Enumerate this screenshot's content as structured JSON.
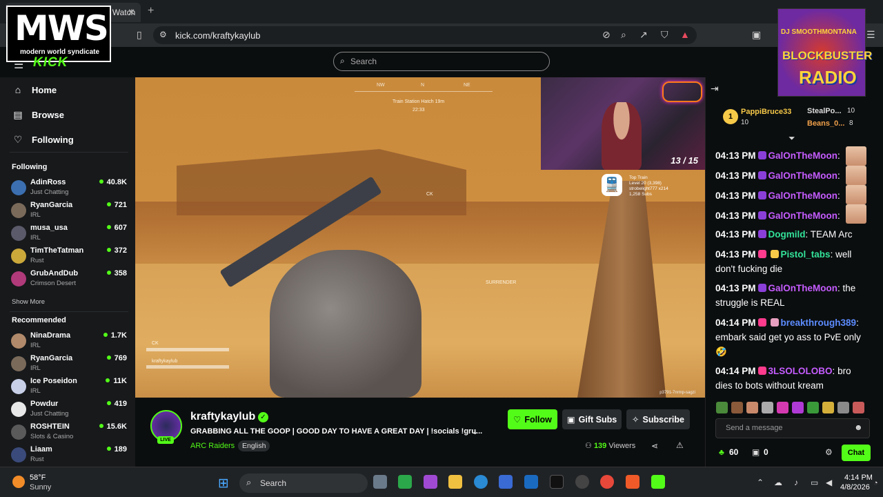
{
  "browser": {
    "tab_title": "kraftykaylub Stream - Watch",
    "tab_close": "✕",
    "new_tab": "+",
    "url": "kick.com/kraftykaylub"
  },
  "overlays": {
    "mws_big": "MWS",
    "mws_small": "modern world syndicate",
    "radio_line1": "DJ SMOOTHMONTANA",
    "radio_line2": "BLOCKBUSTER",
    "radio_line3": "RADIO"
  },
  "header": {
    "logo": "KICK",
    "search_placeholder": "Search"
  },
  "sidebar": {
    "nav": [
      {
        "label": "Home",
        "icon": "home-icon"
      },
      {
        "label": "Browse",
        "icon": "browse-icon"
      },
      {
        "label": "Following",
        "icon": "heart-icon"
      }
    ],
    "following_title": "Following",
    "following": [
      {
        "name": "AdinRoss",
        "category": "Just Chatting",
        "viewers": "40.8K",
        "color": "#3b6fb0"
      },
      {
        "name": "RyanGarcia",
        "category": "IRL",
        "viewers": "721",
        "color": "#7a6a5a"
      },
      {
        "name": "musa_usa",
        "category": "IRL",
        "viewers": "607",
        "color": "#5a5a6a"
      },
      {
        "name": "TimTheTatman",
        "category": "Rust",
        "viewers": "372",
        "color": "#caa83a"
      },
      {
        "name": "GrubAndDub",
        "category": "Crimson Desert",
        "viewers": "358",
        "color": "#b03a7a"
      }
    ],
    "show_more": "Show More",
    "recommended_title": "Recommended",
    "recommended": [
      {
        "name": "NinaDrama",
        "category": "IRL",
        "viewers": "1.7K",
        "color": "#b08a6a"
      },
      {
        "name": "RyanGarcia",
        "category": "IRL",
        "viewers": "769",
        "color": "#7a6a5a"
      },
      {
        "name": "Ice Poseidon",
        "category": "IRL",
        "viewers": "11K",
        "color": "#c8d0e8"
      },
      {
        "name": "Powdur",
        "category": "Just Chatting",
        "viewers": "419",
        "color": "#e8e8e8"
      },
      {
        "name": "ROSHTEIN",
        "category": "Slots & Casino",
        "viewers": "15.6K",
        "color": "#5a5a5a"
      },
      {
        "name": "Liaam",
        "category": "Rust",
        "viewers": "189",
        "color": "#3a4a7a"
      }
    ]
  },
  "video": {
    "compass_left": "NW",
    "compass_mid": "N",
    "compass_right": "NE",
    "objective": "Train Station Hatch 19m",
    "timer": "22:33",
    "marker": "CK",
    "surrender": "SURRENDER",
    "squad": [
      "CK",
      "kraftykaylub"
    ],
    "cam_score": "13 / 15",
    "train_title": "Top Train",
    "train_level": "Level 20 (3,398)",
    "train_user": "strobelight777 x214",
    "train_subs": "1,258 Subs",
    "stream_id": "p3791-7nrmp-sagzi"
  },
  "stream": {
    "channel": "kraftykaylub",
    "live": "LIVE",
    "title": "GRABBING ALL THE GOOP | GOOD DAY TO HAVE A GREAT DAY | !socials !gru...",
    "category": "ARC Raiders",
    "language": "English",
    "follow": "Follow",
    "gift": "Gift Subs",
    "subscribe": "Subscribe",
    "viewers_count": "139",
    "viewers_label": "Viewers"
  },
  "chat": {
    "top_gifters": [
      {
        "name": "PappiBruce33",
        "count": "10",
        "rank": "1"
      },
      {
        "name": "StealPo...",
        "count": "10"
      },
      {
        "name": "Beans_0...",
        "count": "8"
      }
    ],
    "messages": [
      {
        "time": "04:13 PM",
        "user": "GalOnTheMoon",
        "color": "#c55cff",
        "text": ""
      },
      {
        "time": "04:13 PM",
        "user": "GalOnTheMoon",
        "color": "#c55cff",
        "text": ""
      },
      {
        "time": "04:13 PM",
        "user": "GalOnTheMoon",
        "color": "#c55cff",
        "text": ""
      },
      {
        "time": "04:13 PM",
        "user": "GalOnTheMoon",
        "color": "#c55cff",
        "text": ""
      },
      {
        "time": "04:13 PM",
        "user": "Dogmild",
        "color": "#33e39a",
        "text": " TEAM Arc"
      },
      {
        "time": "04:13 PM",
        "user": "Pistol_tabs",
        "color": "#33e39a",
        "text": " well don't fucking die"
      },
      {
        "time": "04:13 PM",
        "user": "GalOnTheMoon",
        "color": "#c55cff",
        "text": " the struggle is REAL"
      },
      {
        "time": "04:14 PM",
        "user": "breakthrough389",
        "color": "#5c8cff",
        "text": " embark said get yo ass to PvE only"
      },
      {
        "time": "04:14 PM",
        "user": "3LSOLOLOBO",
        "color": "#c55cff",
        "text": " bro dies to bots without kream"
      }
    ],
    "send_placeholder": "Send a message",
    "points": "60",
    "gifts": "0",
    "chat_button": "Chat"
  },
  "taskbar": {
    "weather_temp": "58°F",
    "weather_desc": "Sunny",
    "search": "Search",
    "time": "4:14 PM",
    "date": "4/8/2026"
  }
}
